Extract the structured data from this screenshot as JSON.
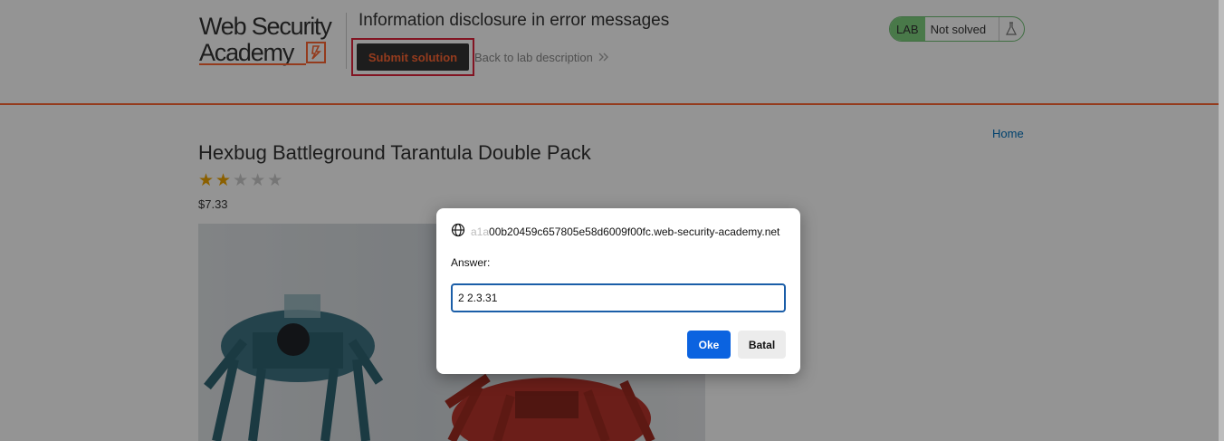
{
  "header": {
    "logo_line1": "Web Security",
    "logo_line2": "Academy",
    "lab_title": "Information disclosure in error messages",
    "submit_label": "Submit solution",
    "back_label": "Back to lab description",
    "status_badge": "LAB",
    "status_text": "Not solved"
  },
  "nav": {
    "home_label": "Home"
  },
  "product": {
    "title": "Hexbug Battleground Tarantula Double Pack",
    "rating": {
      "filled": 2,
      "total": 5
    },
    "price": "$7.33"
  },
  "dialog": {
    "origin_prefix": "a1a",
    "origin_host": "00b20459c657805e58d6009f00fc.web-security-academy.net",
    "prompt_label": "Answer:",
    "input_value": "2 2.3.31",
    "ok_label": "Oke",
    "cancel_label": "Batal"
  },
  "colors": {
    "accent": "#ff6633",
    "submit_highlight": "#e0243c",
    "link": "#0071bc",
    "star_filled": "#f0a500",
    "star_empty": "#cccccc",
    "lab_badge": "#7ed07f",
    "ok_button": "#0b63e0"
  },
  "icons": [
    "lightning-bolt-icon",
    "double-chevron-right-icon",
    "flask-icon",
    "globe-icon",
    "star-icon"
  ]
}
